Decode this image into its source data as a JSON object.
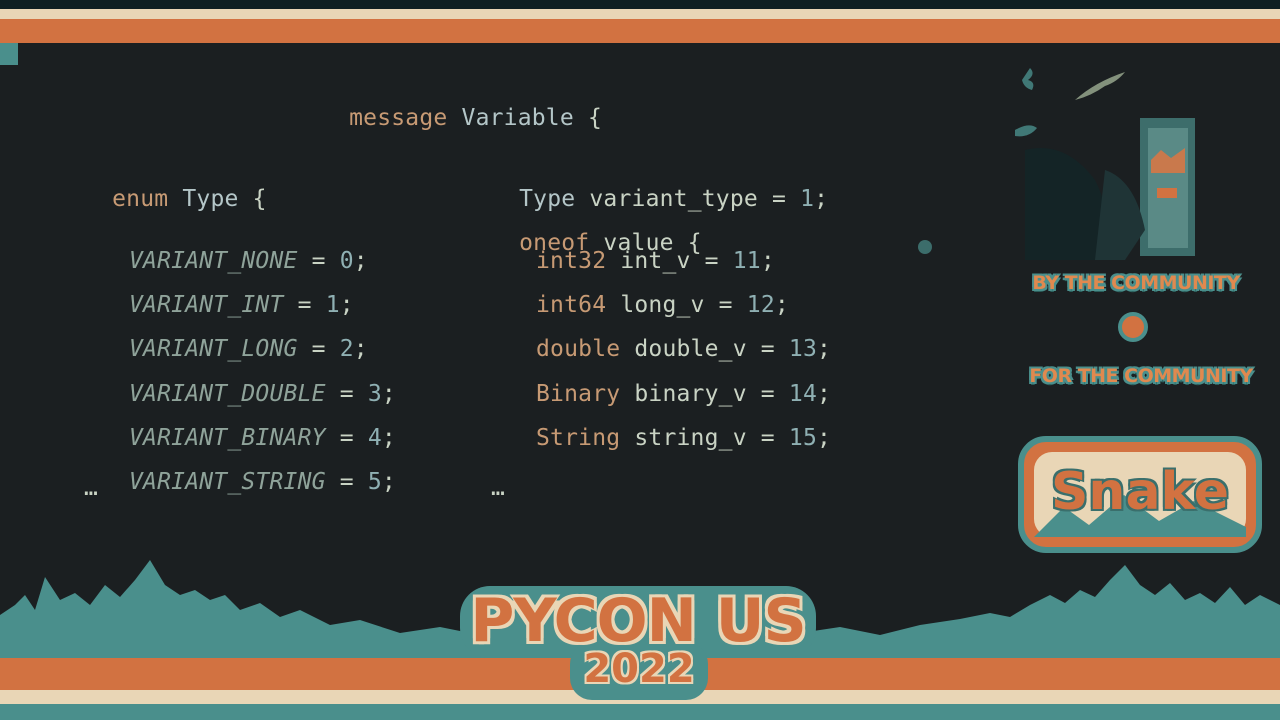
{
  "slide": {
    "header": {
      "kw": "message",
      "name": "Variable",
      "brace": "{"
    },
    "enum_block": {
      "kw": "enum",
      "name": "Type",
      "brace": "{",
      "entries": [
        {
          "name": "VARIANT_NONE",
          "value": "0"
        },
        {
          "name": "VARIANT_INT",
          "value": "1"
        },
        {
          "name": "VARIANT_LONG",
          "value": "2"
        },
        {
          "name": "VARIANT_DOUBLE",
          "value": "3"
        },
        {
          "name": "VARIANT_BINARY",
          "value": "4"
        },
        {
          "name": "VARIANT_STRING",
          "value": "5"
        }
      ],
      "ellipsis": "…"
    },
    "message_block": {
      "field_type": "Type",
      "field_name": "variant_type",
      "field_num": "1",
      "oneof_kw": "oneof",
      "oneof_name": "value",
      "brace": "{",
      "fields": [
        {
          "type": "int32",
          "name": "int_v",
          "num": "11"
        },
        {
          "type": "int64",
          "name": "long_v",
          "num": "12"
        },
        {
          "type": "double",
          "name": "double_v",
          "num": "13"
        },
        {
          "type": "Binary",
          "name": "binary_v",
          "num": "14"
        },
        {
          "type": "String",
          "name": "string_v",
          "num": "15"
        }
      ],
      "ellipsis": "…"
    }
  },
  "sidebar": {
    "tagline_top": "BY THE COMMUNITY",
    "tagline_bottom": "FOR THE COMMUNITY",
    "badge": "Snake"
  },
  "footer": {
    "logo_line1": "PYCON US",
    "logo_line2": "2022"
  },
  "colors": {
    "background": "#1b1f21",
    "orange": "#d27241",
    "teal": "#4a8f8c",
    "cream": "#e9d6b6"
  }
}
